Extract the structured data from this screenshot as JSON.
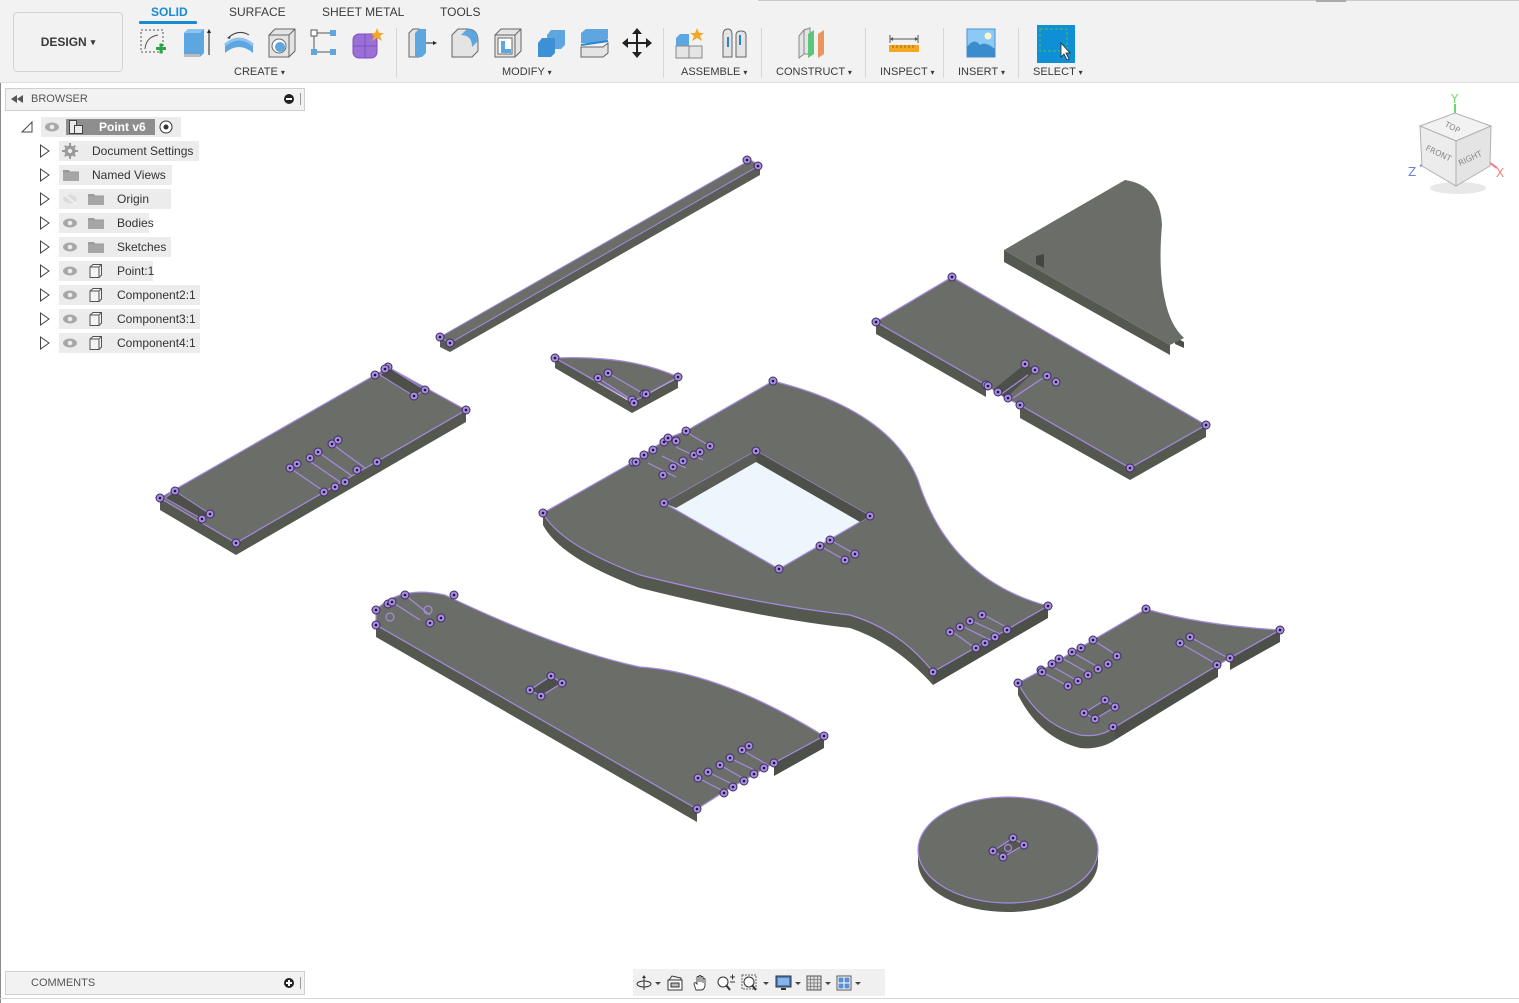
{
  "toolbar": {
    "workspace": "DESIGN",
    "tabs": [
      {
        "label": "SOLID",
        "active": true
      },
      {
        "label": "SURFACE",
        "active": false
      },
      {
        "label": "SHEET METAL",
        "active": false
      },
      {
        "label": "TOOLS",
        "active": false
      }
    ],
    "groups": {
      "create": "CREATE",
      "modify": "MODIFY",
      "assemble": "ASSEMBLE",
      "construct": "CONSTRUCT",
      "inspect": "INSPECT",
      "insert": "INSERT",
      "select": "SELECT"
    },
    "dropdown_glyph": "▾",
    "accent_color": "#1a8bd1"
  },
  "browser": {
    "title": "BROWSER",
    "root": {
      "label": "Point v6"
    },
    "items": [
      {
        "label": "Document Settings",
        "icon": "gear-icon",
        "visible": null
      },
      {
        "label": "Named Views",
        "icon": "folder-icon",
        "visible": null
      },
      {
        "label": "Origin",
        "icon": "folder-icon",
        "visible": false
      },
      {
        "label": "Bodies",
        "icon": "folder-icon",
        "visible": true
      },
      {
        "label": "Sketches",
        "icon": "folder-icon",
        "visible": true
      },
      {
        "label": "Point:1",
        "icon": "component-icon",
        "visible": true
      },
      {
        "label": "Component2:1",
        "icon": "component-icon",
        "visible": true
      },
      {
        "label": "Component3:1",
        "icon": "component-icon",
        "visible": true
      },
      {
        "label": "Component4:1",
        "icon": "component-icon",
        "visible": true
      }
    ]
  },
  "viewcube": {
    "faces": {
      "top": "TOP",
      "front": "FRONT",
      "right": "RIGHT"
    },
    "axes": {
      "x": "X",
      "y": "Y",
      "z": "Z"
    }
  },
  "comments": {
    "title": "COMMENTS"
  },
  "navbar": {
    "items": [
      "orbit",
      "look-at",
      "pan",
      "zoom",
      "fit",
      "display-settings",
      "grid-settings",
      "viewports"
    ]
  },
  "colors": {
    "body_top": "#6b6e68",
    "body_side": "#55584f",
    "edge_highlight": "#a68be0",
    "point_fill": "#6a4fa3"
  }
}
